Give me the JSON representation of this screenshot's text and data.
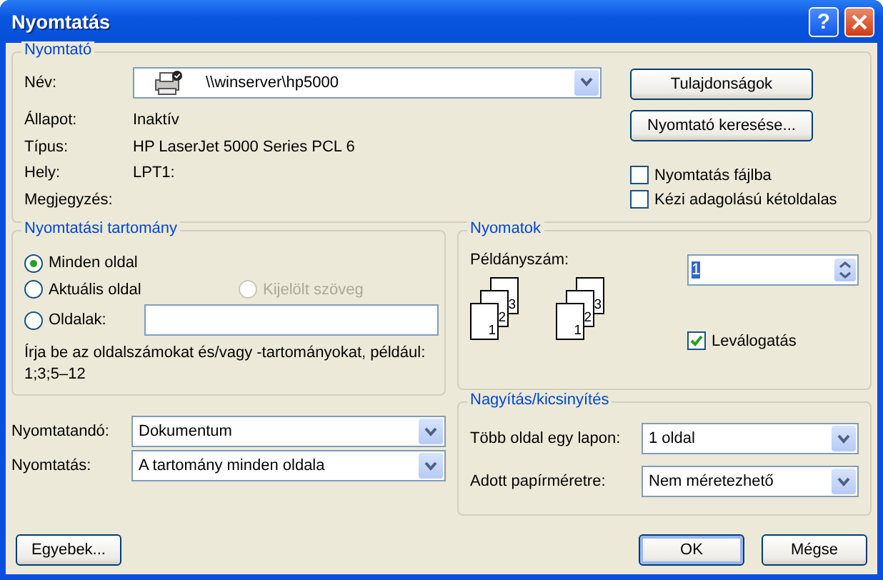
{
  "window": {
    "title": "Nyomtatás",
    "help": "?"
  },
  "printer": {
    "title": "Nyomtató",
    "name_label": "Név:",
    "name_value": "\\\\winserver\\hp5000",
    "fields": [
      {
        "label": "Állapot:",
        "value": "Inaktív"
      },
      {
        "label": "Típus:",
        "value": "HP LaserJet 5000 Series PCL 6"
      },
      {
        "label": "Hely:",
        "value": "LPT1:"
      },
      {
        "label": "Megjegyzés:"
      }
    ],
    "buttons": [
      "Tulajdonságok",
      "Nyomtató keresése..."
    ],
    "checkboxes": [
      {
        "label": "Nyomtatás fájlba",
        "checked": false
      },
      {
        "label": "Kézi adagolású kétoldalas",
        "checked": false
      }
    ]
  },
  "range": {
    "title": "Nyomtatási tartomány",
    "rows": [
      [
        {
          "kind": "plain",
          "label": "Minden oldal",
          "selected": true,
          "disabled": false
        }
      ],
      [
        {
          "kind": "plain",
          "label": "Aktuális oldal",
          "selected": false,
          "disabled": false
        },
        {
          "kind": "plain",
          "label": "Kijelölt szöveg",
          "selected": false,
          "disabled": true
        }
      ],
      [
        {
          "kind": "field",
          "label": "Oldalak:",
          "selected": false,
          "disabled": false
        }
      ]
    ],
    "hint": "Írja be az oldalszámokat és/vagy -tartományokat, például:\n1;3;5–12"
  },
  "selects": [
    {
      "label": "Nyomtatandó:",
      "value": "Dokumentum"
    },
    {
      "label": "Nyomtatás:",
      "value": "A tartomány minden oldala"
    }
  ],
  "copies": {
    "title": "Nyomatok",
    "label": "Példányszám:",
    "value": "1",
    "value_highlighted": true,
    "stacks": [
      {
        "pages": [
          "3",
          "2",
          "1"
        ]
      },
      {
        "pages": [
          "3",
          "2",
          "1"
        ]
      }
    ],
    "collate": {
      "label": "Leválogatás",
      "checked": true
    }
  },
  "zoom": {
    "title": "Nagyítás/kicsinyítés",
    "selects": [
      {
        "label": "Több oldal egy lapon:",
        "value": "1 oldal"
      },
      {
        "label": "Adott papírméretre:",
        "value": "Nem méretezhető"
      }
    ]
  },
  "footer_buttons": [
    {
      "label": "Egyebek...",
      "default": false
    },
    {
      "label": "OK",
      "default": true
    },
    {
      "label": "Mégse",
      "default": false
    }
  ]
}
